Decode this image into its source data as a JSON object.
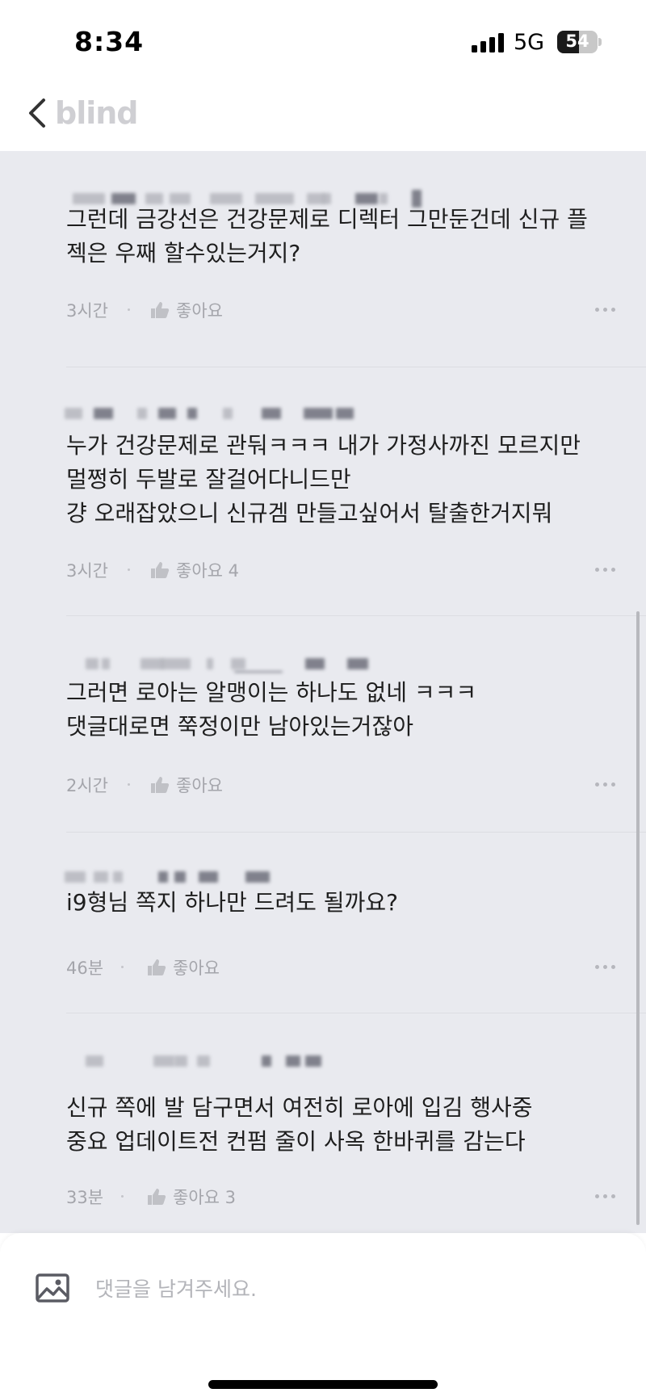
{
  "status_bar": {
    "time": "8:34",
    "network": "5G",
    "battery": "54",
    "battery_level": 0.54
  },
  "header": {
    "logo": "blind",
    "back_icon": "chevron-left-icon"
  },
  "comments": [
    {
      "text": "그런데 금강선은 건강문제로 디렉터 그만둔건데 신규 플\n젝은 우째 할수있는거지?",
      "time": "3시간",
      "like_label": "좋아요"
    },
    {
      "text": "누가 건강문제로 관둬ㅋㅋㅋ 내가 가정사까진 모르지만\n멀쩡히 두발로 잘걸어다니드만\n걍 오래잡았으니 신규겜 만들고싶어서 탈출한거지뭐",
      "time": "3시간",
      "like_label": "좋아요 4"
    },
    {
      "text": "그러면 로아는 알맹이는 하나도 없네 ㅋㅋㅋ\n댓글대로면 쭉정이만 남아있는거잖아",
      "time": "2시간",
      "like_label": "좋아요"
    },
    {
      "text": "i9형님 쪽지 하나만 드려도 될까요?",
      "time": "46분",
      "like_label": "좋아요"
    },
    {
      "text": "신규 쪽에 발 담구면서 여전히 로아에 입김 행사중\n중요 업데이트전 컨펌 줄이 사옥 한바퀴를 감는다",
      "time": "33분",
      "like_label": "좋아요 3"
    }
  ],
  "input": {
    "placeholder": "댓글을 남겨주세요.",
    "image_icon": "image-icon"
  }
}
